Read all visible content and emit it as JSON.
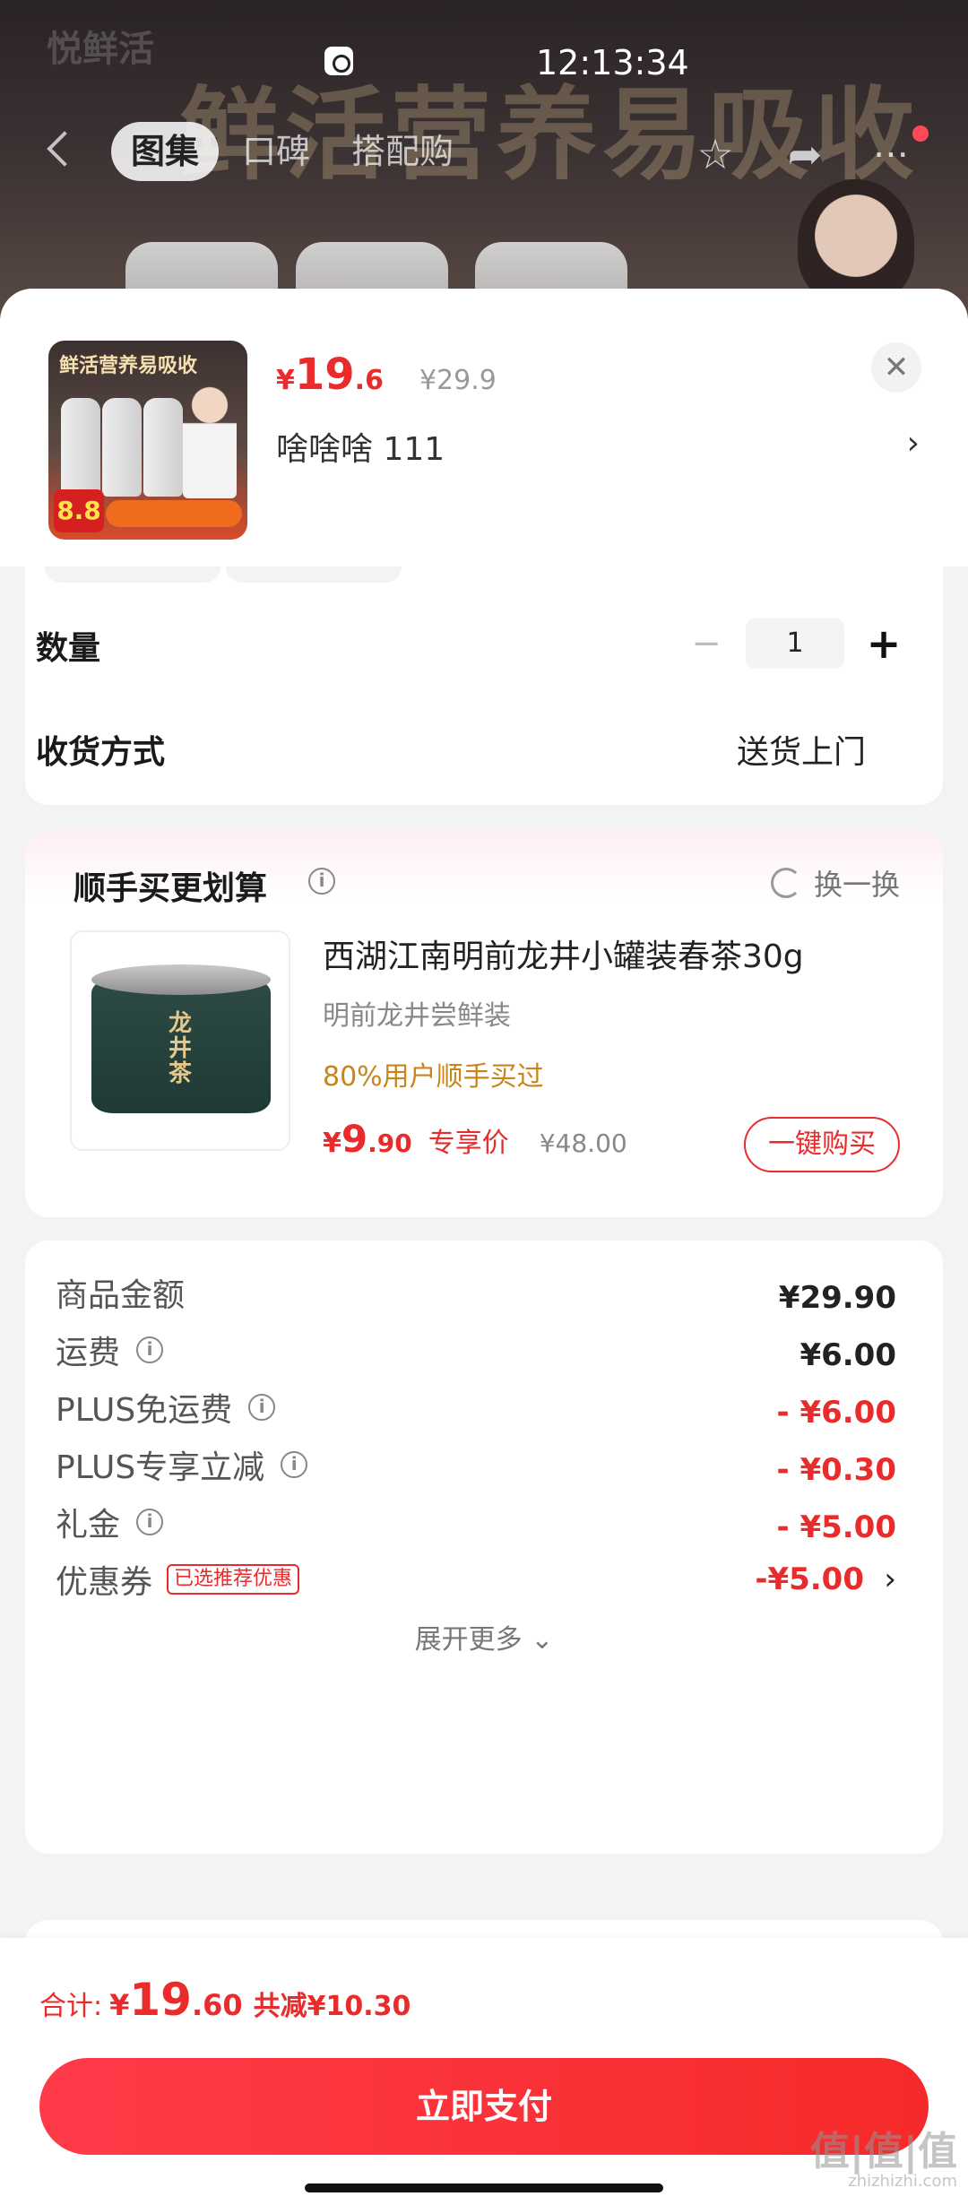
{
  "status_bar": {
    "time": "12:13:34"
  },
  "banner": {
    "logo": "悦鲜活",
    "slogan": "鲜活营养易吸收"
  },
  "nav": {
    "tabs": [
      {
        "label": "图集",
        "active": true
      },
      {
        "label": "口碑",
        "active": false
      },
      {
        "label": "搭配购",
        "active": false
      }
    ]
  },
  "product": {
    "thumb_slogan": "鲜活营养易吸收",
    "thumb_badge": "8.8",
    "price_symbol": "¥",
    "price_int": "19",
    "price_dec": ".6",
    "original_price": "¥29.9",
    "spec": "啥啥啥  111"
  },
  "options": {
    "quantity_label": "数量",
    "quantity_value": "1",
    "delivery_label": "收货方式",
    "delivery_value": "送货上门"
  },
  "recommend": {
    "title": "顺手买更划算",
    "refresh_label": "换一换",
    "item": {
      "image_label": "龙井茶",
      "name": "西湖江南明前龙井小罐装春茶30g",
      "subtitle": "明前龙井尝鲜装",
      "buyers": "80%用户顺手买过",
      "price_symbol": "¥",
      "price_int": "9",
      "price_dec": ".90",
      "price_tag": "专享价",
      "original_price": "¥48.00",
      "buy_label": "一键购买"
    }
  },
  "breakdown": {
    "rows": [
      {
        "label": "商品金额",
        "value": "¥29.90"
      },
      {
        "label": "运费",
        "value": "¥6.00"
      },
      {
        "label": "PLUS免运费",
        "value": "- ¥6.00"
      },
      {
        "label": "PLUS专享立减",
        "value": "- ¥0.30"
      },
      {
        "label": "礼金",
        "value": "- ¥5.00"
      },
      {
        "label": "优惠券",
        "value": "-¥5.00",
        "tag": "已选推荐优惠"
      }
    ],
    "expand_label": "展开更多"
  },
  "footer": {
    "total_label": "合计:",
    "total_symbol": "¥",
    "total_int": "19",
    "total_dec": ".60",
    "saved_label": "共减¥10.30",
    "pay_label": "立即支付"
  },
  "watermark": {
    "main": "值|值|值",
    "sub": "zhizhizhi.com"
  },
  "colors": {
    "accent": "#ea2b2b",
    "buyers": "#c8861a"
  }
}
